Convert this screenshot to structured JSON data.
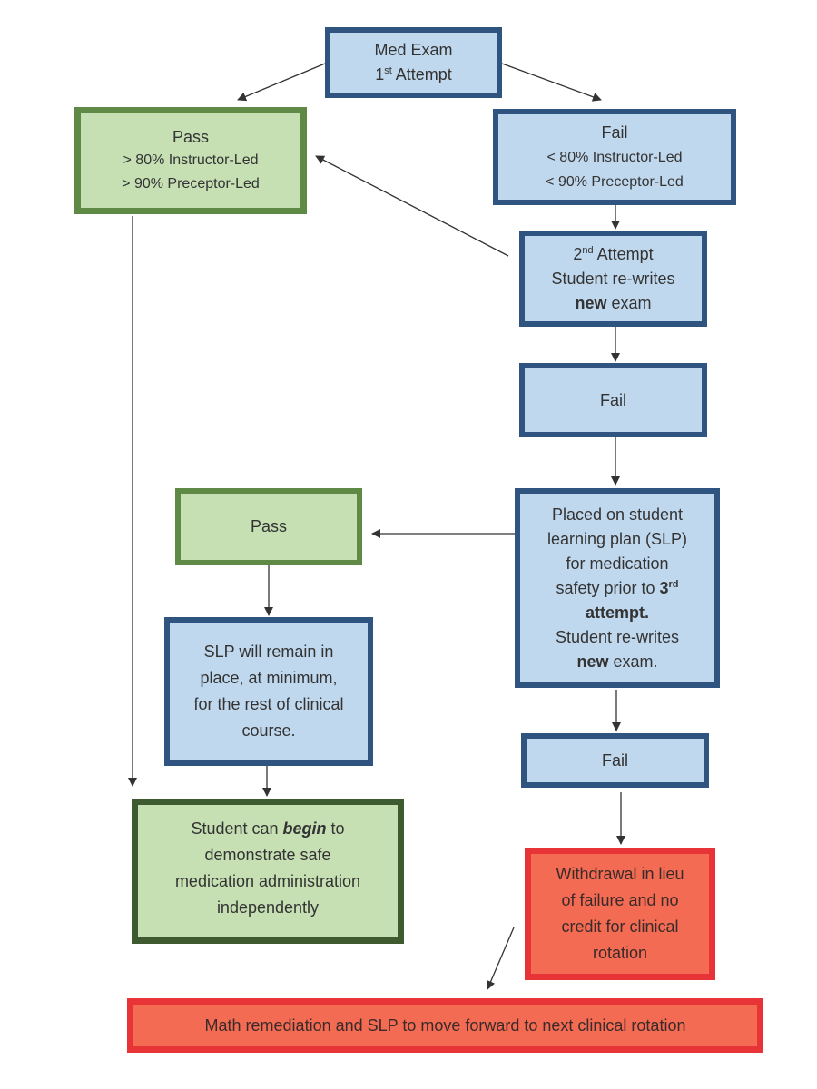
{
  "colors": {
    "blue_fill": "#c0d8ee",
    "blue_border": "#2f5480",
    "green_fill": "#c6e0b4",
    "green_border": "#5f8a45",
    "dark_green_border": "#3e5a31",
    "red_fill": "#f26b52",
    "red_border": "#e83437"
  },
  "nodes": {
    "med_exam": {
      "line1": "Med Exam",
      "num": "1",
      "sup": "st",
      "rest": " Attempt"
    },
    "pass1": {
      "title": "Pass",
      "line2": "> 80% Instructor-Led",
      "line3": "> 90% Preceptor-Led"
    },
    "fail1": {
      "title": "Fail",
      "line2": "< 80% Instructor-Led",
      "line3": "< 90% Preceptor-Led"
    },
    "attempt2": {
      "num": "2",
      "sup": "nd",
      "rest": " Attempt",
      "line2": "Student re-writes",
      "bold": "new",
      "rest3": " exam"
    },
    "fail2": {
      "title": "Fail"
    },
    "slp": {
      "line1": "Placed on student",
      "line2": "learning plan (SLP)",
      "line3": "for medication",
      "line4": "safety prior to ",
      "num": "3",
      "sup": "rd",
      "line5": "attempt.",
      "line6": "Student re-writes",
      "bold": "new",
      "rest7": " exam."
    },
    "pass2": {
      "title": "Pass"
    },
    "remain": {
      "line1": "SLP will remain in",
      "line2": "place, at minimum,",
      "line3": "for the rest of clinical",
      "line4": "course."
    },
    "begin": {
      "pre": "Student can ",
      "em": "begin",
      "post": " to",
      "line2": "demonstrate safe",
      "line3": "medication administration",
      "line4": "independently"
    },
    "fail3": {
      "title": "Fail"
    },
    "withdraw": {
      "line1": "Withdrawal in lieu",
      "line2": "of failure and no",
      "line3": "credit for clinical",
      "line4": "rotation"
    },
    "math": {
      "text": "Math remediation and SLP to move forward to next clinical rotation"
    }
  }
}
